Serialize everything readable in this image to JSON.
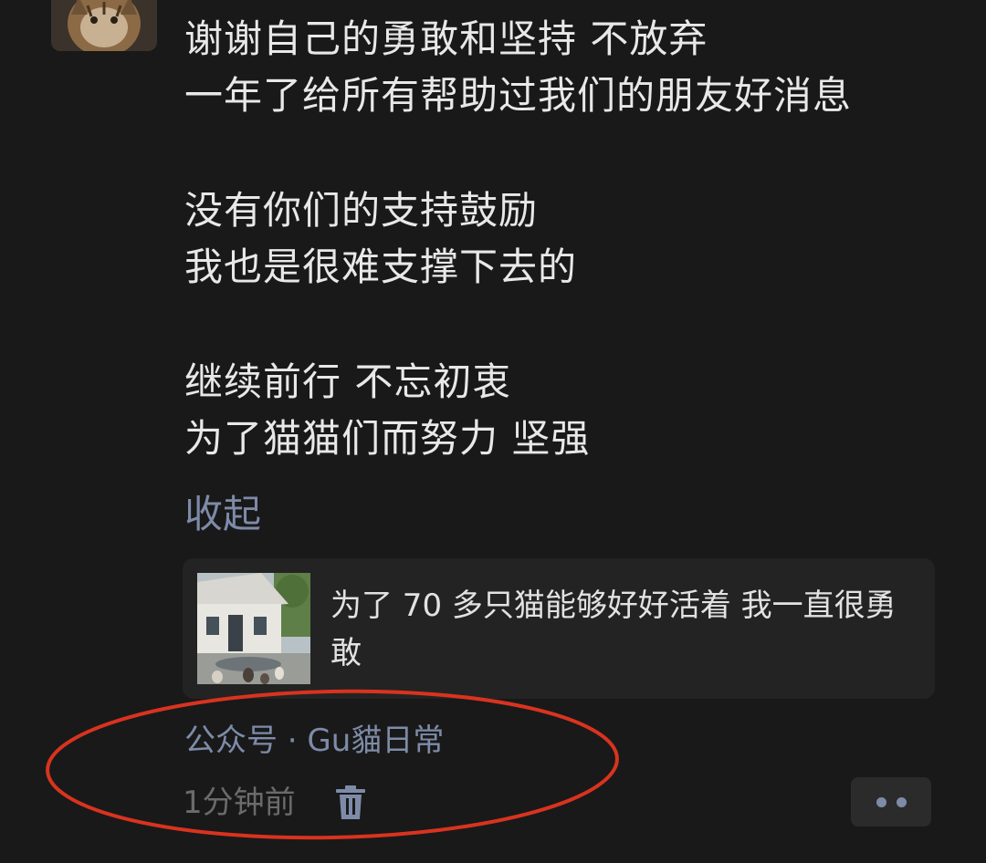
{
  "post": {
    "lines": [
      "谢谢自己的勇敢和坚持 不放弃",
      "一年了给所有帮助过我们的朋友好消息",
      "没有你们的支持鼓励",
      "我也是很难支撑下去的",
      "继续前行 不忘初衷",
      "为了猫猫们而努力 坚强"
    ],
    "collapse_label": "收起"
  },
  "share_card": {
    "title": "为了 70 多只猫能够好好活着 我一直很勇敢"
  },
  "meta": {
    "source": "公众号 · Gu貓日常",
    "time": "1分钟前"
  },
  "icons": {
    "delete": "trash-icon",
    "more": "more-dots-icon"
  },
  "colors": {
    "background": "#191919",
    "text": "#e8e8e8",
    "link": "#7e8ba8",
    "muted": "#6b6b6b",
    "card": "#232323",
    "annotation": "#d9331f"
  }
}
